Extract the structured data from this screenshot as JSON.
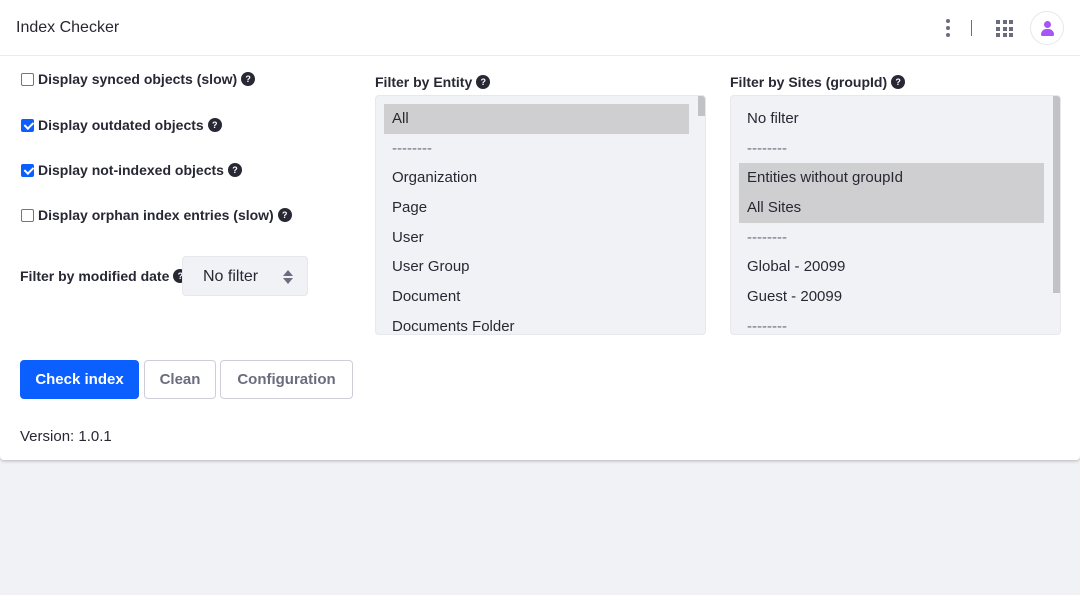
{
  "header": {
    "title": "Index Checker"
  },
  "options": [
    {
      "label": "Display synced objects (slow)",
      "checked": false
    },
    {
      "label": "Display outdated objects",
      "checked": true
    },
    {
      "label": "Display not-indexed objects",
      "checked": true
    },
    {
      "label": "Display orphan index entries (slow)",
      "checked": false
    }
  ],
  "date_filter": {
    "label": "Filter by modified date",
    "value": "No filter"
  },
  "help_glyph": "?",
  "entity_filter": {
    "title": "Filter by Entity",
    "items": [
      "All",
      "--------",
      "Organization",
      "Page",
      "User",
      "User Group",
      "Document",
      "Documents Folder"
    ],
    "selected": [
      "All"
    ]
  },
  "sites_filter": {
    "title": "Filter by Sites (groupId)",
    "items": [
      "No filter",
      "--------",
      "Entities without groupId",
      "All Sites",
      "--------",
      "Global - 20099",
      "Guest - 20099",
      "--------"
    ],
    "selected": [
      "Entities without groupId",
      "All Sites"
    ]
  },
  "actions": {
    "check_label": "Check index",
    "clean_label": "Clean",
    "config_label": "Configuration"
  },
  "footer": {
    "version": "Version: 1.0.1"
  },
  "colors": {
    "primary": "#0b5fff",
    "avatar": "#a855f7",
    "selected_option": "#cfcfd1"
  }
}
